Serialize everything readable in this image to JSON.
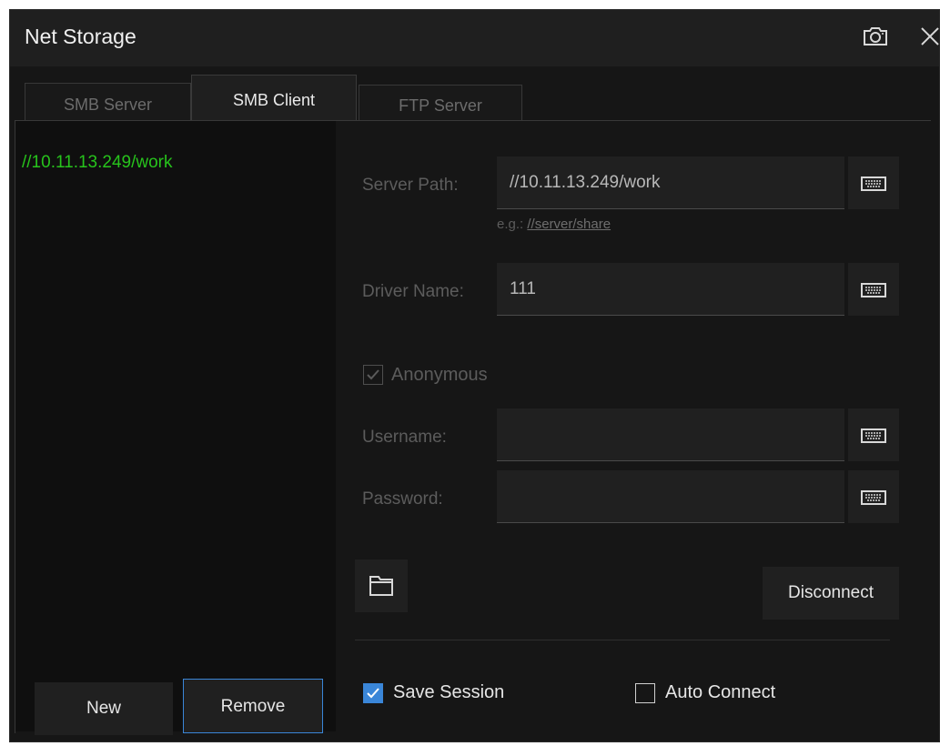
{
  "window": {
    "title": "Net Storage"
  },
  "tabs": [
    {
      "label": "SMB Server"
    },
    {
      "label": "SMB Client",
      "active": true
    },
    {
      "label": "FTP Server"
    }
  ],
  "session_list": {
    "items": [
      "//10.11.13.249/work"
    ]
  },
  "form": {
    "server_path": {
      "label": "Server Path:",
      "value": "//10.11.13.249/work"
    },
    "example": {
      "prefix": "e.g.:",
      "link": "//server/share"
    },
    "driver_name": {
      "label": "Driver Name:",
      "value": "111"
    },
    "anonymous": {
      "label": "Anonymous",
      "checked": true,
      "enabled": false
    },
    "username": {
      "label": "Username:",
      "value": ""
    },
    "password": {
      "label": "Password:",
      "value": ""
    }
  },
  "buttons": {
    "disconnect": "Disconnect",
    "new": "New",
    "remove": "Remove"
  },
  "options": {
    "save_session": {
      "label": "Save Session",
      "checked": true
    },
    "auto_connect": {
      "label": "Auto Connect",
      "checked": false
    }
  },
  "icons": {
    "camera": "camera-icon",
    "close": "close-icon",
    "keyboard": "keyboard-icon",
    "folder": "folder-icon",
    "check": "checkmark-icon"
  },
  "colors": {
    "background": "#161616",
    "panel": "#0f0f0f",
    "accent": "#3a86d8",
    "list_item": "#27c31c"
  }
}
